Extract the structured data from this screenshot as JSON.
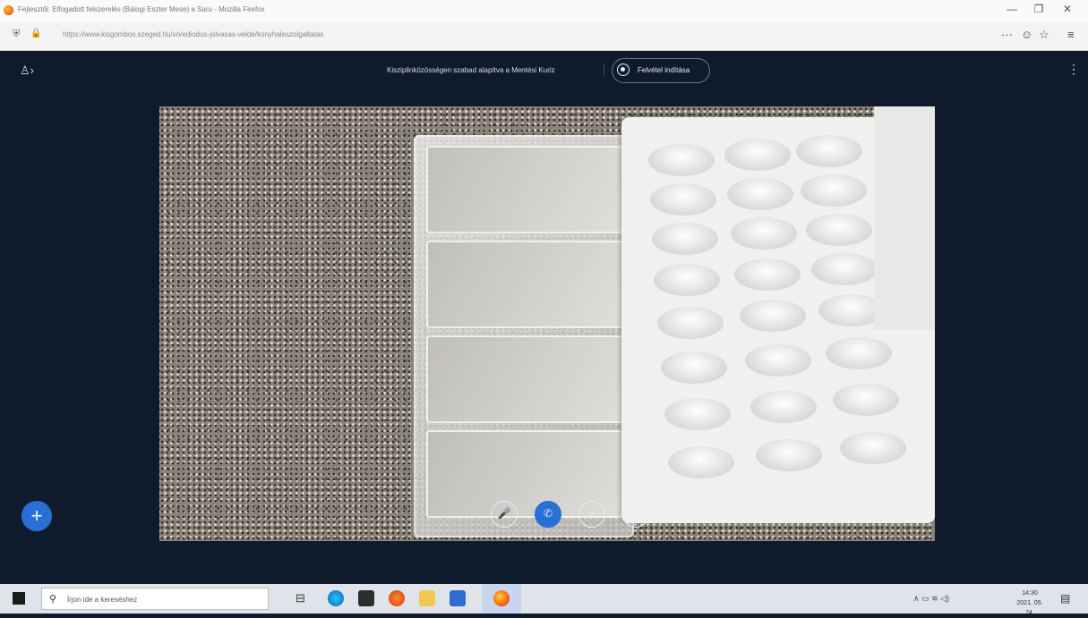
{
  "browser": {
    "tab_title": "Fejlesztői: Elfogadott felszerelés (Bálogi Eszter Mese) a Saru - Mozilla Firefox",
    "url": "https://www.kisgombos.szeged.hu/vo/ediodus-jolvasas-velde/konyhaleszolgaltatas",
    "minimize": "—",
    "maximize": "❐",
    "close": "✕",
    "overflow": "···",
    "pocket": "☺",
    "bookmark": "☆",
    "menu": "≡"
  },
  "meeting": {
    "participants_icon": "participants-icon",
    "participants_glyph": "♙›",
    "title": "Kisziplinközösségen szabad alapítva a Mentési Kuriz",
    "separator": "|",
    "record_label": "Felvétel indítása",
    "more_glyph": "⋮"
  },
  "controls": {
    "add": "+",
    "mute": "🎤",
    "hangup": "✆",
    "camera": "⌀",
    "screen": "▭"
  },
  "taskbar": {
    "search_placeholder": "Írjon ide a kereséshez",
    "search_glyph": "⚲",
    "taskview": "⊟",
    "tray": "∧ ▭ ≋ ◁)",
    "time": "14:30",
    "date": "2021. 05. 24.",
    "notifications": "▤"
  },
  "colors": {
    "app_bg": "#0f1b2d",
    "accent": "#2a6fd6"
  }
}
